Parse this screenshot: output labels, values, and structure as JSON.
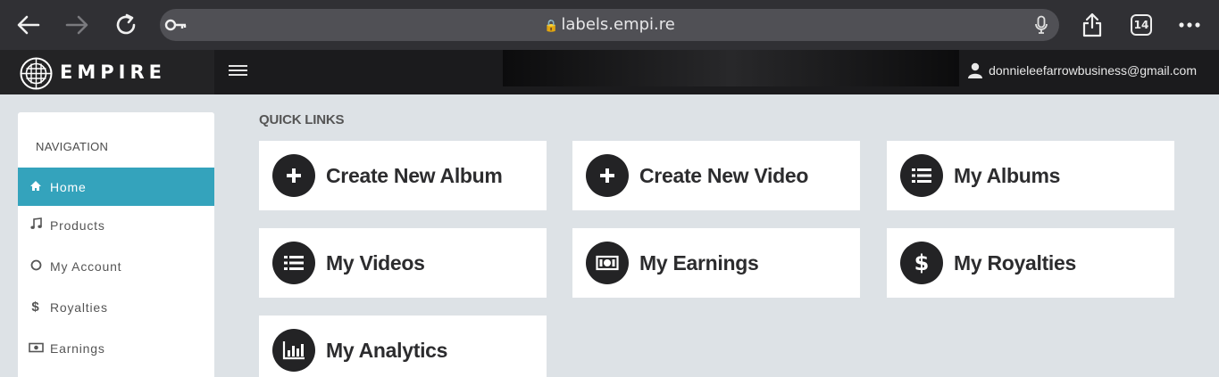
{
  "browser": {
    "url": "labels.empi.re",
    "tab_count": "14",
    "icons": [
      "back-arrow-icon",
      "forward-arrow-icon",
      "reload-icon",
      "key-icon",
      "lock-icon",
      "microphone-icon",
      "share-icon",
      "tabs-icon",
      "more-icon"
    ]
  },
  "header": {
    "logo_text": "EMPIRE",
    "user_email": "donnieleefarrowbusiness@gmail.com"
  },
  "sidebar": {
    "title": "NAVIGATION",
    "items": [
      {
        "label": "Home",
        "icon": "home-icon",
        "active": true
      },
      {
        "label": "Products",
        "icon": "music-note-icon",
        "active": false
      },
      {
        "label": "My Account",
        "icon": "circle-icon",
        "active": false
      },
      {
        "label": "Royalties",
        "icon": "dollar-icon",
        "active": false
      },
      {
        "label": "Earnings",
        "icon": "money-icon",
        "active": false
      }
    ]
  },
  "quick_links": {
    "title": "QUICK LINKS",
    "items": [
      {
        "label": "Create New Album",
        "icon": "plus-icon"
      },
      {
        "label": "Create New Video",
        "icon": "plus-icon"
      },
      {
        "label": "My Albums",
        "icon": "list-icon"
      },
      {
        "label": "My Videos",
        "icon": "list-icon"
      },
      {
        "label": "My Earnings",
        "icon": "money-icon"
      },
      {
        "label": "My Royalties",
        "icon": "dollar-icon"
      },
      {
        "label": "My Analytics",
        "icon": "bar-chart-icon"
      }
    ]
  },
  "colors": {
    "accent": "#34a3bc",
    "header_bg": "#1b1b1d",
    "page_bg": "#dde2e6",
    "browser_bg": "#303034"
  }
}
